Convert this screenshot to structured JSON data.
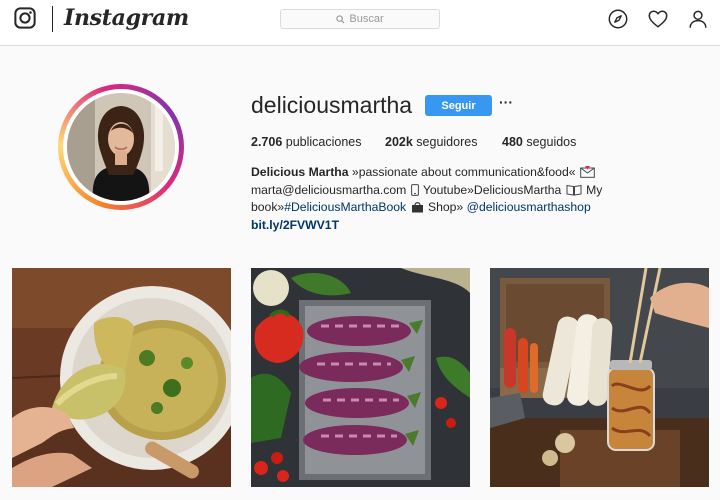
{
  "header": {
    "brand": "Instagram",
    "search_placeholder": "Buscar"
  },
  "profile": {
    "username": "deliciousmartha",
    "follow_label": "Seguir",
    "more_label": "···",
    "stats": {
      "posts_value": "2.706",
      "posts_label": "publicaciones",
      "followers_value": "202k",
      "followers_label": "seguidores",
      "following_value": "480",
      "following_label": "seguidos"
    },
    "bio": {
      "full_name": "Delicious Martha",
      "line1_rest": "»passionate about communication&food«",
      "line2_a": "marta@deliciousmartha.com",
      "line2_b": "Youtube»DeliciousMartha",
      "line2_c": "My",
      "line3_a": "book»",
      "line3_hashtag": "#DeliciousMarthaBook",
      "line3_b": "Shop»",
      "line3_mention": "@deliciousmarthashop",
      "link": "bit.ly/2FVWV1T"
    }
  },
  "posts": [
    {
      "subject": "tortilla"
    },
    {
      "subject": "eggplants"
    },
    {
      "subject": "pickled vegetables"
    }
  ],
  "colors": {
    "accent": "#3897f0",
    "link": "#003569",
    "text": "#262626",
    "background": "#fafafa"
  }
}
